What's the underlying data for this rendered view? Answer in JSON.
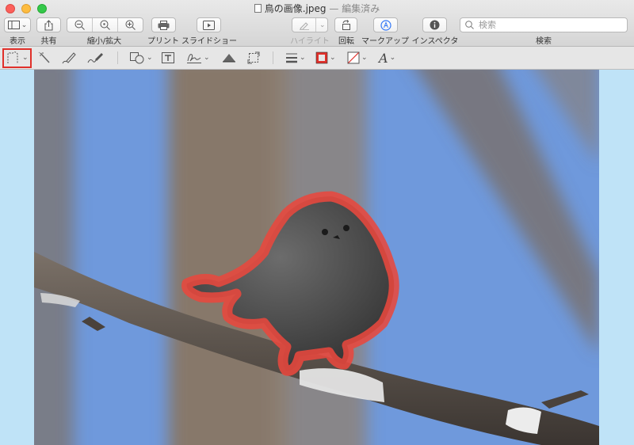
{
  "window": {
    "title": "鳥の画像.jpeg",
    "title_separator": "—",
    "edited_status": "編集済み"
  },
  "toolbar": {
    "view_label": "表示",
    "share_label": "共有",
    "zoom_label": "縮小/拡大",
    "print_label": "プリント",
    "slideshow_label": "スライドショー",
    "highlight_label": "ハイライト",
    "rotate_label": "回転",
    "markup_label": "マークアップ",
    "inspector_label": "インスペクタ",
    "search_label": "検索",
    "search_placeholder": "検索"
  },
  "markup_toolbar": {
    "tools": [
      "selection-tool",
      "instant-alpha",
      "sketch",
      "draw",
      "shapes",
      "text",
      "sign",
      "adjust-color",
      "adjust-size",
      "shape-style",
      "border-color",
      "fill-color",
      "text-style"
    ],
    "text_style_glyph": "A",
    "selected_tool": "selection-tool",
    "selection_highlight_color": "#e0302a"
  },
  "image": {
    "description_subject": "bird on branch",
    "selection_outline_color": "#e8483e",
    "sky_color": "#6f99dc"
  }
}
